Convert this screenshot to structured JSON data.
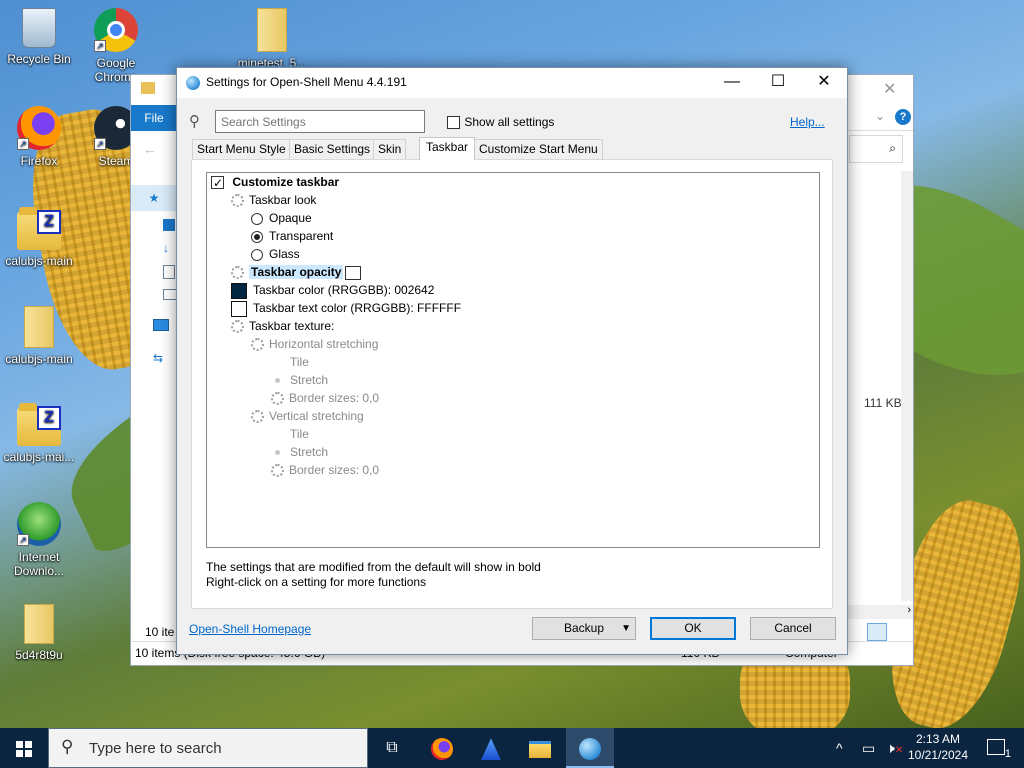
{
  "desktop": {
    "icons": [
      {
        "label": "Recycle Bin",
        "icon": "recycle-bin-icon"
      },
      {
        "label": "Google Chrome",
        "icon": "chrome-icon"
      },
      {
        "label": "minetest_5...",
        "icon": "folder-icon"
      },
      {
        "label": "Firefox",
        "icon": "firefox-icon"
      },
      {
        "label": "Steam",
        "icon": "steam-icon"
      },
      {
        "label": "calubjs-main",
        "icon": "zip-folder-icon"
      },
      {
        "label": "calubjs-main",
        "icon": "folder-icon"
      },
      {
        "label": "calubjs-mai...",
        "icon": "zip-folder-icon"
      },
      {
        "label": "Internet Downlo...",
        "icon": "idm-icon"
      },
      {
        "label": "5d4r8t9u",
        "icon": "folder-icon"
      }
    ]
  },
  "explorer": {
    "file_tab": "File",
    "size_label": "111 KB",
    "status_left": "10 items (Disk free space: 45.6 GB)",
    "status_mid": "110 KB",
    "status_right": "Computer",
    "items_count": "10 ite"
  },
  "dialog": {
    "title": "Settings for Open-Shell Menu 4.4.191",
    "search_placeholder": "Search Settings",
    "show_all_label": "Show all settings",
    "help_link": "Help...",
    "tabs": [
      {
        "label": "Start Menu Style"
      },
      {
        "label": "Basic Settings"
      },
      {
        "label": "Skin"
      },
      {
        "label": "Taskbar"
      },
      {
        "label": "Customize Start Menu"
      }
    ],
    "tree": {
      "customize_taskbar": "Customize taskbar",
      "taskbar_look": "Taskbar look",
      "opaque": "Opaque",
      "transparent": "Transparent",
      "glass": "Glass",
      "taskbar_opacity": "Taskbar opacity",
      "taskbar_color": "Taskbar color (RRGGBB): 002642",
      "taskbar_text_color": "Taskbar text color (RRGGBB): FFFFFF",
      "taskbar_texture": "Taskbar texture:",
      "horizontal_stretching": "Horizontal stretching",
      "h_tile": "Tile",
      "h_stretch": "Stretch",
      "h_border": "Border sizes: 0,0",
      "vertical_stretching": "Vertical stretching",
      "v_tile": "Tile",
      "v_stretch": "Stretch",
      "v_border": "Border sizes: 0,0",
      "taskbar_color_hex": "#002642",
      "taskbar_text_color_hex": "#FFFFFF"
    },
    "note_line1": "The settings that are modified from the default will show in bold",
    "note_line2": "Right-click on a setting for more functions",
    "homepage_link": "Open-Shell Homepage",
    "backup_label": "Backup",
    "ok_label": "OK",
    "cancel_label": "Cancel"
  },
  "taskbar": {
    "search_placeholder": "Type here to search",
    "time": "2:13 AM",
    "date": "10/21/2024",
    "notification_count": "1"
  }
}
